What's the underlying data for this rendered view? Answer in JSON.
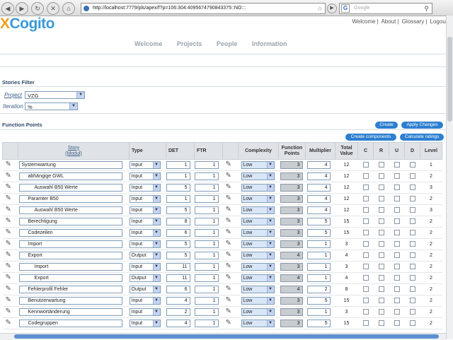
{
  "browser": {
    "url": "http://localhost:7779/pls/apex/f?p=106:304:4095674790843375::NO:::",
    "search_placeholder": "Google"
  },
  "header": {
    "logo_x": "X",
    "logo_text": "Cogito",
    "links": [
      "Welcome",
      "About",
      "Glossary",
      "Logout"
    ],
    "nav": [
      "Welcome",
      "Projects",
      "People",
      "Information"
    ]
  },
  "filter": {
    "title": "Stories Filter",
    "project_label": "Project",
    "project_value": "VZG",
    "iteration_label": "Iteration",
    "iteration_value": "%"
  },
  "function_points": {
    "title": "Function Points",
    "buttons": {
      "create": "Create",
      "apply": "Apply Changes",
      "create_components": "Create components",
      "calculate": "Calculate ratings"
    },
    "columns": {
      "story": "Story",
      "model": "(Modul)",
      "type": "Type",
      "det": "DET",
      "ftr": "FTR",
      "complexity": "Complexity",
      "fp1": "Function",
      "fp2": "Points",
      "multiplier": "Multiplier",
      "tv1": "Total",
      "tv2": "Value",
      "c": "C",
      "r": "R",
      "u": "U",
      "d": "D",
      "level": "Level"
    },
    "rows": [
      {
        "story": "Systemwartung",
        "indent": 0,
        "type": "Input",
        "det": "1",
        "ftr": "1",
        "complexity": "Low",
        "fp": "3",
        "mult": "4",
        "total": "12",
        "level": "1"
      },
      {
        "story": "abhängige GWL",
        "indent": 1,
        "type": "Input",
        "det": "1",
        "ftr": "1",
        "complexity": "Low",
        "fp": "3",
        "mult": "4",
        "total": "12",
        "level": "2"
      },
      {
        "story": "Auswahl B50 Werte",
        "indent": 2,
        "type": "Input",
        "det": "5",
        "ftr": "1",
        "complexity": "Low",
        "fp": "3",
        "mult": "4",
        "total": "12",
        "level": "3"
      },
      {
        "story": "Paramter B50",
        "indent": 1,
        "type": "Input",
        "det": "1",
        "ftr": "1",
        "complexity": "Low",
        "fp": "3",
        "mult": "4",
        "total": "12",
        "level": "2"
      },
      {
        "story": "Auswahl B50 Werte",
        "indent": 2,
        "type": "Input",
        "det": "5",
        "ftr": "1",
        "complexity": "Low",
        "fp": "3",
        "mult": "4",
        "total": "12",
        "level": "3"
      },
      {
        "story": "Berechtigung",
        "indent": 1,
        "type": "Input",
        "det": "8",
        "ftr": "1",
        "complexity": "Low",
        "fp": "3",
        "mult": "5",
        "total": "15",
        "level": "2"
      },
      {
        "story": "Codezeilen",
        "indent": 1,
        "type": "Input",
        "det": "6",
        "ftr": "1",
        "complexity": "Low",
        "fp": "3",
        "mult": "5",
        "total": "15",
        "level": "2"
      },
      {
        "story": "Import",
        "indent": 1,
        "type": "Input",
        "det": "5",
        "ftr": "1",
        "complexity": "Low",
        "fp": "3",
        "mult": "1",
        "total": "3",
        "level": "2"
      },
      {
        "story": "Export",
        "indent": 1,
        "type": "Output",
        "det": "5",
        "ftr": "1",
        "complexity": "Low",
        "fp": "4",
        "mult": "1",
        "total": "4",
        "level": "2"
      },
      {
        "story": "Import",
        "indent": 2,
        "type": "Input",
        "det": "11",
        "ftr": "1",
        "complexity": "Low",
        "fp": "3",
        "mult": "1",
        "total": "3",
        "level": "2"
      },
      {
        "story": "Export",
        "indent": 2,
        "type": "Output",
        "det": "11",
        "ftr": "1",
        "complexity": "Low",
        "fp": "4",
        "mult": "1",
        "total": "4",
        "level": "2"
      },
      {
        "story": "Fehlerprofil Fehler",
        "indent": 1,
        "type": "Output",
        "det": "6",
        "ftr": "1",
        "complexity": "Low",
        "fp": "4",
        "mult": "2",
        "total": "8",
        "level": "2"
      },
      {
        "story": "Benutzerwartung",
        "indent": 1,
        "type": "Input",
        "det": "4",
        "ftr": "1",
        "complexity": "Low",
        "fp": "3",
        "mult": "5",
        "total": "15",
        "level": "2"
      },
      {
        "story": "Kennwortänderung",
        "indent": 1,
        "type": "Input",
        "det": "2",
        "ftr": "1",
        "complexity": "Low",
        "fp": "3",
        "mult": "1",
        "total": "3",
        "level": "2"
      },
      {
        "story": "Codegruppen",
        "indent": 1,
        "type": "Input",
        "det": "4",
        "ftr": "1",
        "complexity": "Low",
        "fp": "3",
        "mult": "5",
        "total": "15",
        "level": "2"
      }
    ]
  },
  "colors": {
    "logo_blue": "#3a9ad9",
    "logo_orange": "#f0a020",
    "button_blue": "#2d7fd0",
    "header_grey": "#dfe3e7"
  }
}
